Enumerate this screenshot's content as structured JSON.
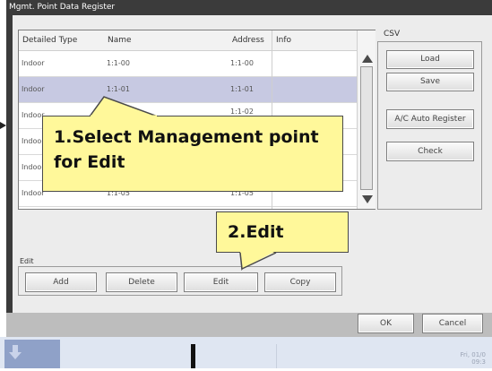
{
  "window": {
    "title": "Mgmt. Point Data Register"
  },
  "table": {
    "columns": [
      "Detailed Type",
      "Name",
      "Address",
      "Info"
    ],
    "rows": [
      {
        "type": "Indoor",
        "name": "1:1-00",
        "address": "1:1-00",
        "info": "",
        "selected": false
      },
      {
        "type": "Indoor",
        "name": "1:1-01",
        "address": "1:1-01",
        "info": "",
        "selected": true
      },
      {
        "type": "Indoor",
        "name": "",
        "address": "1:1-02",
        "info": "",
        "selected": false
      },
      {
        "type": "Indoo",
        "name": "",
        "address": "",
        "info": "",
        "selected": false
      },
      {
        "type": "Indoo",
        "name": "",
        "address": "",
        "info": "",
        "selected": false
      },
      {
        "type": "Indoor",
        "name": "1:1-05",
        "address": "1:1-05",
        "info": "",
        "selected": false
      }
    ]
  },
  "csv": {
    "label": "CSV",
    "load": "Load",
    "save": "Save"
  },
  "actions": {
    "ac_auto_register": "A/C Auto Register",
    "check": "Check"
  },
  "edit": {
    "label": "Edit",
    "add": "Add",
    "delete": "Delete",
    "edit": "Edit",
    "copy": "Copy"
  },
  "footer": {
    "ok": "OK",
    "cancel": "Cancel"
  },
  "callouts": {
    "step1_line1": "1.Select Management point",
    "step1_line2": "for Edit",
    "step2": "2.Edit"
  },
  "taskbar": {
    "date": "Fri, 01/0",
    "time": "09:3"
  },
  "colors": {
    "selected_row": "#c7c9e2",
    "callout": "#fff89a",
    "window": "#3b3b3b"
  }
}
